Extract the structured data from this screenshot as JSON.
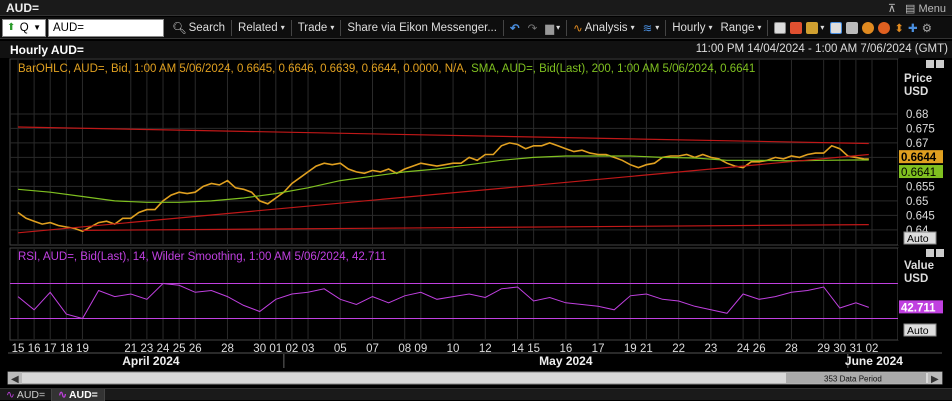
{
  "window": {
    "title": "AUD=",
    "menu_label": "Menu"
  },
  "toolbar": {
    "ric_selector": "Q",
    "ric_input": "AUD=",
    "search": "Search",
    "related": "Related",
    "trade": "Trade",
    "share": "Share via Eikon Messenger...",
    "analysis": "Analysis",
    "interval": "Hourly",
    "range": "Range"
  },
  "chart_header": {
    "title": "Hourly AUD=",
    "range": "11:00 PM 14/04/2024 - 1:00 AM 7/06/2024 (GMT)"
  },
  "colors": {
    "price": "#e0a020",
    "sma": "#7fc020",
    "rsi": "#c040e0",
    "trend": "#c01818",
    "bg": "#000000",
    "grid": "#2a2a2a"
  },
  "chart_data": [
    {
      "type": "line",
      "title": "BarOHLC, AUD=, Bid, 1:00 AM 5/06/2024, 0.6645, 0.6646, 0.6639, 0.6644, 0.0000, N/A,",
      "title_sma": "SMA, AUD=, Bid(Last), 200, 1:00 AM 5/06/2024, 0.6641",
      "y_axis_title": "Price",
      "y_axis_unit": "USD",
      "ylim": [
        0.6365,
        0.6855
      ],
      "yticks": [
        0.68,
        0.675,
        0.67,
        0.665,
        0.66,
        0.655,
        0.65,
        0.645,
        0.64
      ],
      "ytick_labels": [
        "0.68",
        "0.675",
        "0.67",
        "0.665",
        "0.66",
        "0.655",
        "0.65",
        "0.645",
        "0.64"
      ],
      "auto_label": "Auto",
      "last_price_label": "0.6644",
      "last_sma_label": "0.6641",
      "last_price": 0.6644,
      "last_sma": 0.6641,
      "series": [
        {
          "name": "AUD=",
          "day": [
            15,
            15.5,
            16,
            16.5,
            17,
            17.5,
            18,
            18.5,
            19,
            19.5,
            20,
            20.5,
            21,
            21.5,
            22,
            22.5,
            23,
            23.5,
            24,
            24.5,
            25,
            25.5,
            26,
            26.5,
            27,
            27.5,
            28,
            28.5,
            29,
            29.5,
            30,
            30.5,
            31,
            31.5,
            32,
            32.5,
            33,
            33.5,
            34,
            34.5,
            35,
            35.5,
            36,
            36.5,
            37,
            37.5,
            38,
            38.5,
            39,
            39.5,
            40,
            40.5,
            41,
            41.5,
            42,
            42.5,
            43,
            43.5,
            44,
            44.5,
            45,
            45.5,
            46,
            46.5,
            47,
            47.5,
            48,
            48.5,
            49,
            49.5,
            50,
            50.5,
            51,
            51.5,
            52,
            52.5,
            53,
            53.5,
            54,
            54.5,
            55,
            55.5,
            56,
            56.5,
            57,
            57.5,
            58,
            58.5,
            59,
            59.5,
            60,
            60.5,
            61,
            61.5,
            62,
            62.5,
            63,
            63.5,
            64,
            64.5,
            65,
            65.5,
            66,
            66.5,
            67,
            67.5,
            67.8
          ],
          "values": [
            0.646,
            0.644,
            0.643,
            0.642,
            0.6425,
            0.6415,
            0.641,
            0.6405,
            0.6395,
            0.641,
            0.6425,
            0.643,
            0.642,
            0.644,
            0.644,
            0.646,
            0.647,
            0.647,
            0.65,
            0.652,
            0.653,
            0.6525,
            0.653,
            0.655,
            0.656,
            0.6555,
            0.657,
            0.6545,
            0.654,
            0.653,
            0.65,
            0.649,
            0.651,
            0.653,
            0.656,
            0.658,
            0.66,
            0.662,
            0.663,
            0.6625,
            0.663,
            0.661,
            0.66,
            0.6595,
            0.6605,
            0.66,
            0.661,
            0.6595,
            0.661,
            0.662,
            0.663,
            0.6625,
            0.662,
            0.6625,
            0.663,
            0.663,
            0.665,
            0.664,
            0.666,
            0.666,
            0.669,
            0.67,
            0.6695,
            0.668,
            0.669,
            0.669,
            0.67,
            0.669,
            0.668,
            0.667,
            0.6675,
            0.6665,
            0.666,
            0.666,
            0.665,
            0.664,
            0.6625,
            0.6615,
            0.6625,
            0.663,
            0.665,
            0.6655,
            0.6655,
            0.666,
            0.665,
            0.666,
            0.665,
            0.6645,
            0.663,
            0.662,
            0.6615,
            0.6635,
            0.6635,
            0.664,
            0.665,
            0.6645,
            0.6655,
            0.665,
            0.666,
            0.6665,
            0.6665,
            0.669,
            0.668,
            0.6655,
            0.665,
            0.6645,
            0.6644
          ]
        },
        {
          "name": "SMA 200",
          "day": [
            15,
            17,
            19,
            21,
            23,
            25,
            27,
            29,
            31,
            33,
            35,
            37,
            39,
            41,
            43,
            45,
            47,
            49,
            51,
            53,
            55,
            57,
            59,
            61,
            63,
            65,
            67,
            67.8
          ],
          "values": [
            0.654,
            0.653,
            0.6515,
            0.65,
            0.6495,
            0.6495,
            0.65,
            0.651,
            0.6525,
            0.6545,
            0.657,
            0.6585,
            0.66,
            0.661,
            0.6625,
            0.664,
            0.665,
            0.6655,
            0.6655,
            0.6655,
            0.665,
            0.6648,
            0.664,
            0.664,
            0.6638,
            0.664,
            0.6641,
            0.6641
          ]
        },
        {
          "name": "Upper trend",
          "day": [
            15,
            67.8
          ],
          "values": [
            0.6755,
            0.6698
          ]
        },
        {
          "name": "Lower trend",
          "day": [
            15,
            67.8
          ],
          "values": [
            0.639,
            0.666
          ]
        },
        {
          "name": "Base trend",
          "day": [
            19,
            67.8
          ],
          "values": [
            0.6398,
            0.6418
          ]
        }
      ]
    },
    {
      "type": "line",
      "title": "RSI, AUD=, Bid(Last), 14, Wilder Smoothing, 1:00 AM 5/06/2024, 42.711",
      "y_axis_title": "Value",
      "y_axis_unit": "USD",
      "ylim": [
        10,
        90
      ],
      "bands": [
        70,
        30
      ],
      "last_value_label": "42.711",
      "last_value": 42.711,
      "auto_label": "Auto",
      "series": [
        {
          "name": "RSI",
          "day": [
            15,
            16,
            17,
            18,
            19,
            20,
            21,
            22,
            23,
            24,
            25,
            26,
            27,
            28,
            29,
            30,
            31,
            32,
            33,
            34,
            35,
            36,
            37,
            38,
            39,
            40,
            41,
            42,
            43,
            44,
            45,
            46,
            47,
            48,
            49,
            50,
            51,
            52,
            53,
            54,
            55,
            56,
            57,
            58,
            59,
            60,
            61,
            62,
            63,
            64,
            65,
            66,
            67,
            67.8
          ],
          "values": [
            55,
            40,
            60,
            35,
            30,
            62,
            55,
            58,
            52,
            70,
            68,
            60,
            62,
            55,
            45,
            38,
            52,
            58,
            60,
            64,
            52,
            46,
            55,
            48,
            56,
            60,
            52,
            55,
            58,
            54,
            64,
            66,
            50,
            54,
            48,
            46,
            44,
            40,
            56,
            58,
            52,
            50,
            44,
            40,
            36,
            58,
            52,
            55,
            60,
            62,
            66,
            42,
            48,
            42.711
          ]
        }
      ]
    }
  ],
  "x_axis": {
    "days": [
      15,
      16,
      17,
      18,
      19,
      22,
      23,
      24,
      25,
      26,
      28,
      30,
      31,
      32,
      33,
      35,
      37,
      39,
      40,
      42,
      44,
      46,
      47,
      49,
      51,
      53,
      54,
      56,
      58,
      60,
      61,
      63,
      65,
      66,
      67,
      68
    ],
    "labels": [
      "15",
      "16",
      "17",
      "18",
      "19",
      "21",
      "23",
      "24",
      "25",
      "26",
      "28",
      "30",
      "01",
      "02",
      "03",
      "05",
      "07",
      "08",
      "09",
      "10",
      "12",
      "14",
      "15",
      "16",
      "17",
      "19",
      "21",
      "22",
      "23",
      "24",
      "26",
      "28",
      "29",
      "30",
      "31",
      "02"
    ],
    "months": [
      "April 2024",
      "May 2024",
      "June 2024"
    ]
  },
  "scrollbar": {
    "label": "353 Data Period"
  },
  "bottom_tabs": [
    "AUD=",
    "AUD="
  ]
}
